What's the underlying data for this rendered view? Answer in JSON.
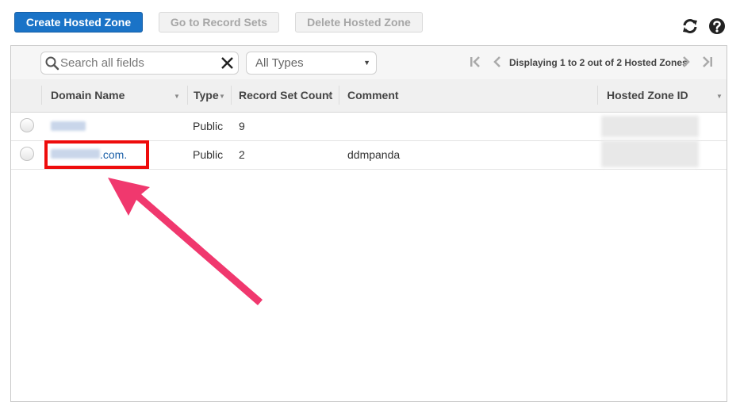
{
  "toolbar": {
    "create_label": "Create Hosted Zone",
    "goto_label": "Go to Record Sets",
    "delete_label": "Delete Hosted Zone"
  },
  "icons": {
    "refresh": "refresh-icon",
    "help": "help-icon"
  },
  "filter": {
    "search_placeholder": "Search all fields",
    "type_select_value": "All Types",
    "pagination_text": "Displaying 1 to 2 out of 2 Hosted Zones"
  },
  "table": {
    "columns": [
      "Domain Name",
      "Type",
      "Record Set Count",
      "Comment",
      "Hosted Zone ID"
    ],
    "rows": [
      {
        "domain_suffix": "",
        "type": "Public",
        "record_count": "9",
        "comment": ""
      },
      {
        "domain_suffix": ".com.",
        "type": "Public",
        "record_count": "2",
        "comment": "ddmpanda"
      }
    ]
  },
  "colors": {
    "primary_button": "#1a73c7",
    "highlight_box": "#ee0c0c",
    "annotation_arrow": "#f0386e",
    "link": "#1a5fa8"
  }
}
